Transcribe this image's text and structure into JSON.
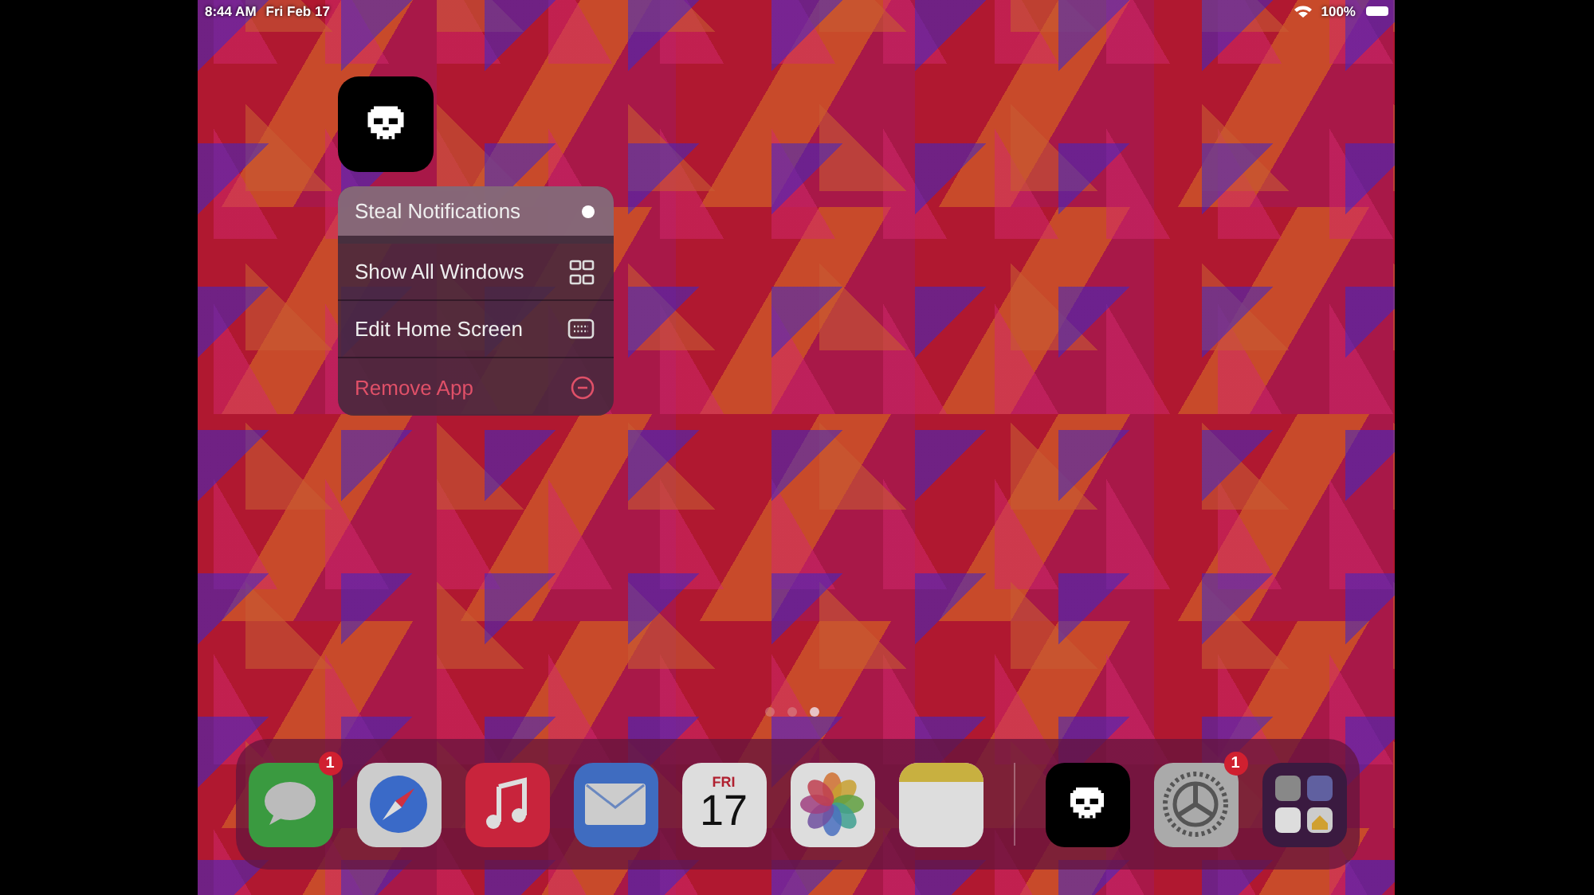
{
  "status_bar": {
    "time": "8:44 AM",
    "date": "Fri Feb 17",
    "battery": "100%"
  },
  "app": {
    "kind": "skull"
  },
  "context_menu": [
    {
      "label": "Steal Notifications",
      "destructive": false,
      "selected": true
    },
    {
      "label": "Show All Windows",
      "destructive": false,
      "selected": false
    },
    {
      "label": "Edit Home Screen",
      "destructive": false,
      "selected": false
    },
    {
      "label": "Remove App",
      "destructive": true,
      "selected": false
    }
  ],
  "page_dots": [
    {
      "selected": false
    },
    {
      "selected": false
    },
    {
      "selected": true
    }
  ],
  "dock": [
    {
      "kind": "messages",
      "badge": "1"
    },
    {
      "kind": "safari"
    },
    {
      "kind": "music"
    },
    {
      "kind": "mail"
    },
    {
      "kind": "calendar",
      "day": "FRI",
      "date": "17"
    },
    {
      "kind": "photos"
    },
    {
      "kind": "notes"
    },
    {
      "kind": "divider"
    },
    {
      "kind": "skull"
    },
    {
      "kind": "settings",
      "badge": "1"
    },
    {
      "kind": "library"
    }
  ]
}
